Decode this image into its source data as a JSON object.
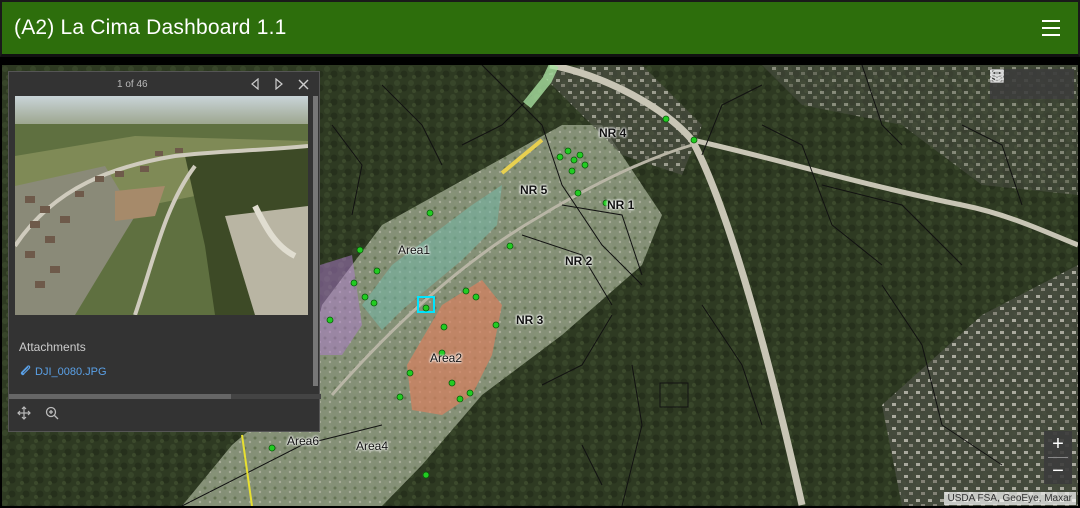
{
  "header": {
    "title": "(A2) La Cima Dashboard 1.1"
  },
  "popup": {
    "counter": "1 of 46",
    "attachments_title": "Attachments",
    "attachment_file": "DJI_0080.JPG"
  },
  "map": {
    "labels": {
      "nr4": "NR 4",
      "nr5": "NR 5",
      "nr1": "NR 1",
      "nr2": "NR 2",
      "nr3": "NR 3",
      "area1": "Area1",
      "area2": "Area2",
      "area4": "Area4",
      "area6": "Area6"
    },
    "zoom_in": "+",
    "zoom_out": "−",
    "attribution": "USDA FSA, GeoEye, Maxar"
  },
  "colors": {
    "header_bg": "#2d6e0c",
    "point": "#22cc22",
    "link": "#5aa0e6",
    "highlight": "#00e5ff"
  }
}
